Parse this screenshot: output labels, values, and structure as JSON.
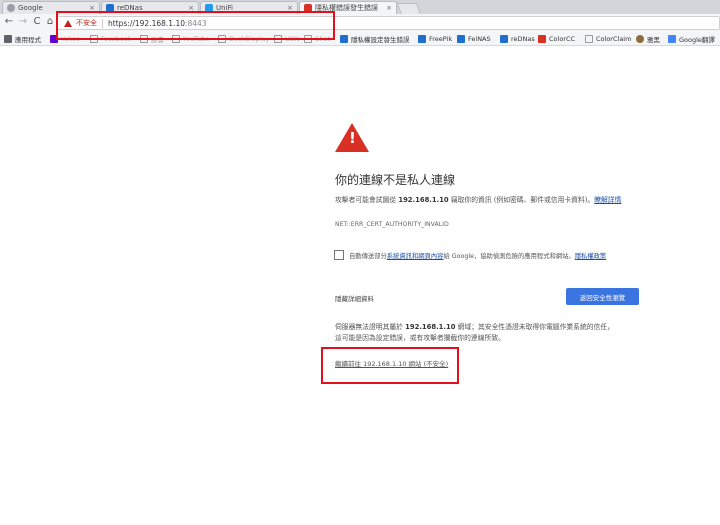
{
  "tabs": [
    {
      "label": "Google",
      "icon": "google-g-icon",
      "color": "#9aa0a6"
    },
    {
      "label": "reDNas",
      "icon": "redrive-icon",
      "color": "#1f6fd1"
    },
    {
      "label": "UniFi",
      "icon": "unifi-icon",
      "color": "#1e9be9"
    },
    {
      "label": "隱私權錯誤發生錯誤",
      "icon": "warning-tab-icon",
      "color": "#d93025"
    }
  ],
  "toolbar": {
    "back_icon": "←",
    "forward_icon": "→",
    "reload_icon": "C",
    "home_icon": "⌂",
    "insecure_label": "不安全",
    "url_host": "https://192.168.1.10",
    "url_port": ":8443"
  },
  "bookmarks": [
    {
      "label": "應用程式",
      "icon": "apps-grid-icon",
      "color": "#5f6368"
    },
    {
      "label": "Yahoo",
      "icon": "yahoo-icon",
      "color": "#6001d2"
    },
    {
      "label": "Facebook",
      "icon": "page-icon",
      "color": "#888888"
    },
    {
      "label": "臉書",
      "icon": "page-icon",
      "color": "#888888"
    },
    {
      "label": "YouTube",
      "icon": "page-icon",
      "color": "#888888"
    },
    {
      "label": "DuckDisplay",
      "icon": "page-icon",
      "color": "#888888"
    },
    {
      "label": "UDN",
      "icon": "page-icon",
      "color": "#888888"
    },
    {
      "label": "Chat",
      "icon": "page-icon",
      "color": "#888888"
    },
    {
      "label": "隱私權設定發生錯誤",
      "icon": "u-icon",
      "color": "#1f6fd1"
    },
    {
      "label": "FreePik",
      "icon": "freepik-icon",
      "color": "#1f6fd1"
    },
    {
      "label": "FeiNAS",
      "icon": "feinas-icon",
      "color": "#1f6fd1"
    },
    {
      "label": "reDNas",
      "icon": "redrive-icon",
      "color": "#1f6fd1"
    },
    {
      "label": "ColorCC",
      "icon": "adobe-icon",
      "color": "#d93025"
    },
    {
      "label": "ColorClaim",
      "icon": "page-icon",
      "color": "#888888"
    },
    {
      "label": "雅黑",
      "icon": "cookie-icon",
      "color": "#8a6d3b"
    },
    {
      "label": "Google翻譯",
      "icon": "translate-icon",
      "color": "#4285f4"
    }
  ],
  "interstitial": {
    "heading": "你的連線不是私人連線",
    "para1_prefix": "攻擊者可能會試圖從 ",
    "para1_host": "192.168.1.10",
    "para1_suffix": " 竊取你的資訊 (例如密碼、郵件或信用卡資料)。",
    "para1_link": "瞭解詳情",
    "error_code": "NET::ERR_CERT_AUTHORITY_INVALID",
    "checkbox_prefix": "自動傳送部分",
    "checkbox_link": "系統資訊和網頁內容",
    "checkbox_middle": "給 Google，協助偵測危險的應用程式和網站。",
    "privacy_link": "隱私權政策",
    "details_button": "隱藏詳細資料",
    "back_button": "返回安全性瀏覽",
    "para2_prefix": "伺服器無法證明其屬於 ",
    "para2_host": "192.168.1.10",
    "para2_line1_suffix": " 網域；其安全性憑證未取得你電腦作業系統的信任，",
    "para2_line2": "這可能是因為設定錯誤，或有攻擊者攔截你的連線所致。",
    "proceed_link": "繼續前往 192.168.1.10 網站 (不安全)"
  },
  "colors": {
    "highlight": "#e0101c",
    "primary_button": "#3a74e0",
    "warning": "#d93025"
  }
}
